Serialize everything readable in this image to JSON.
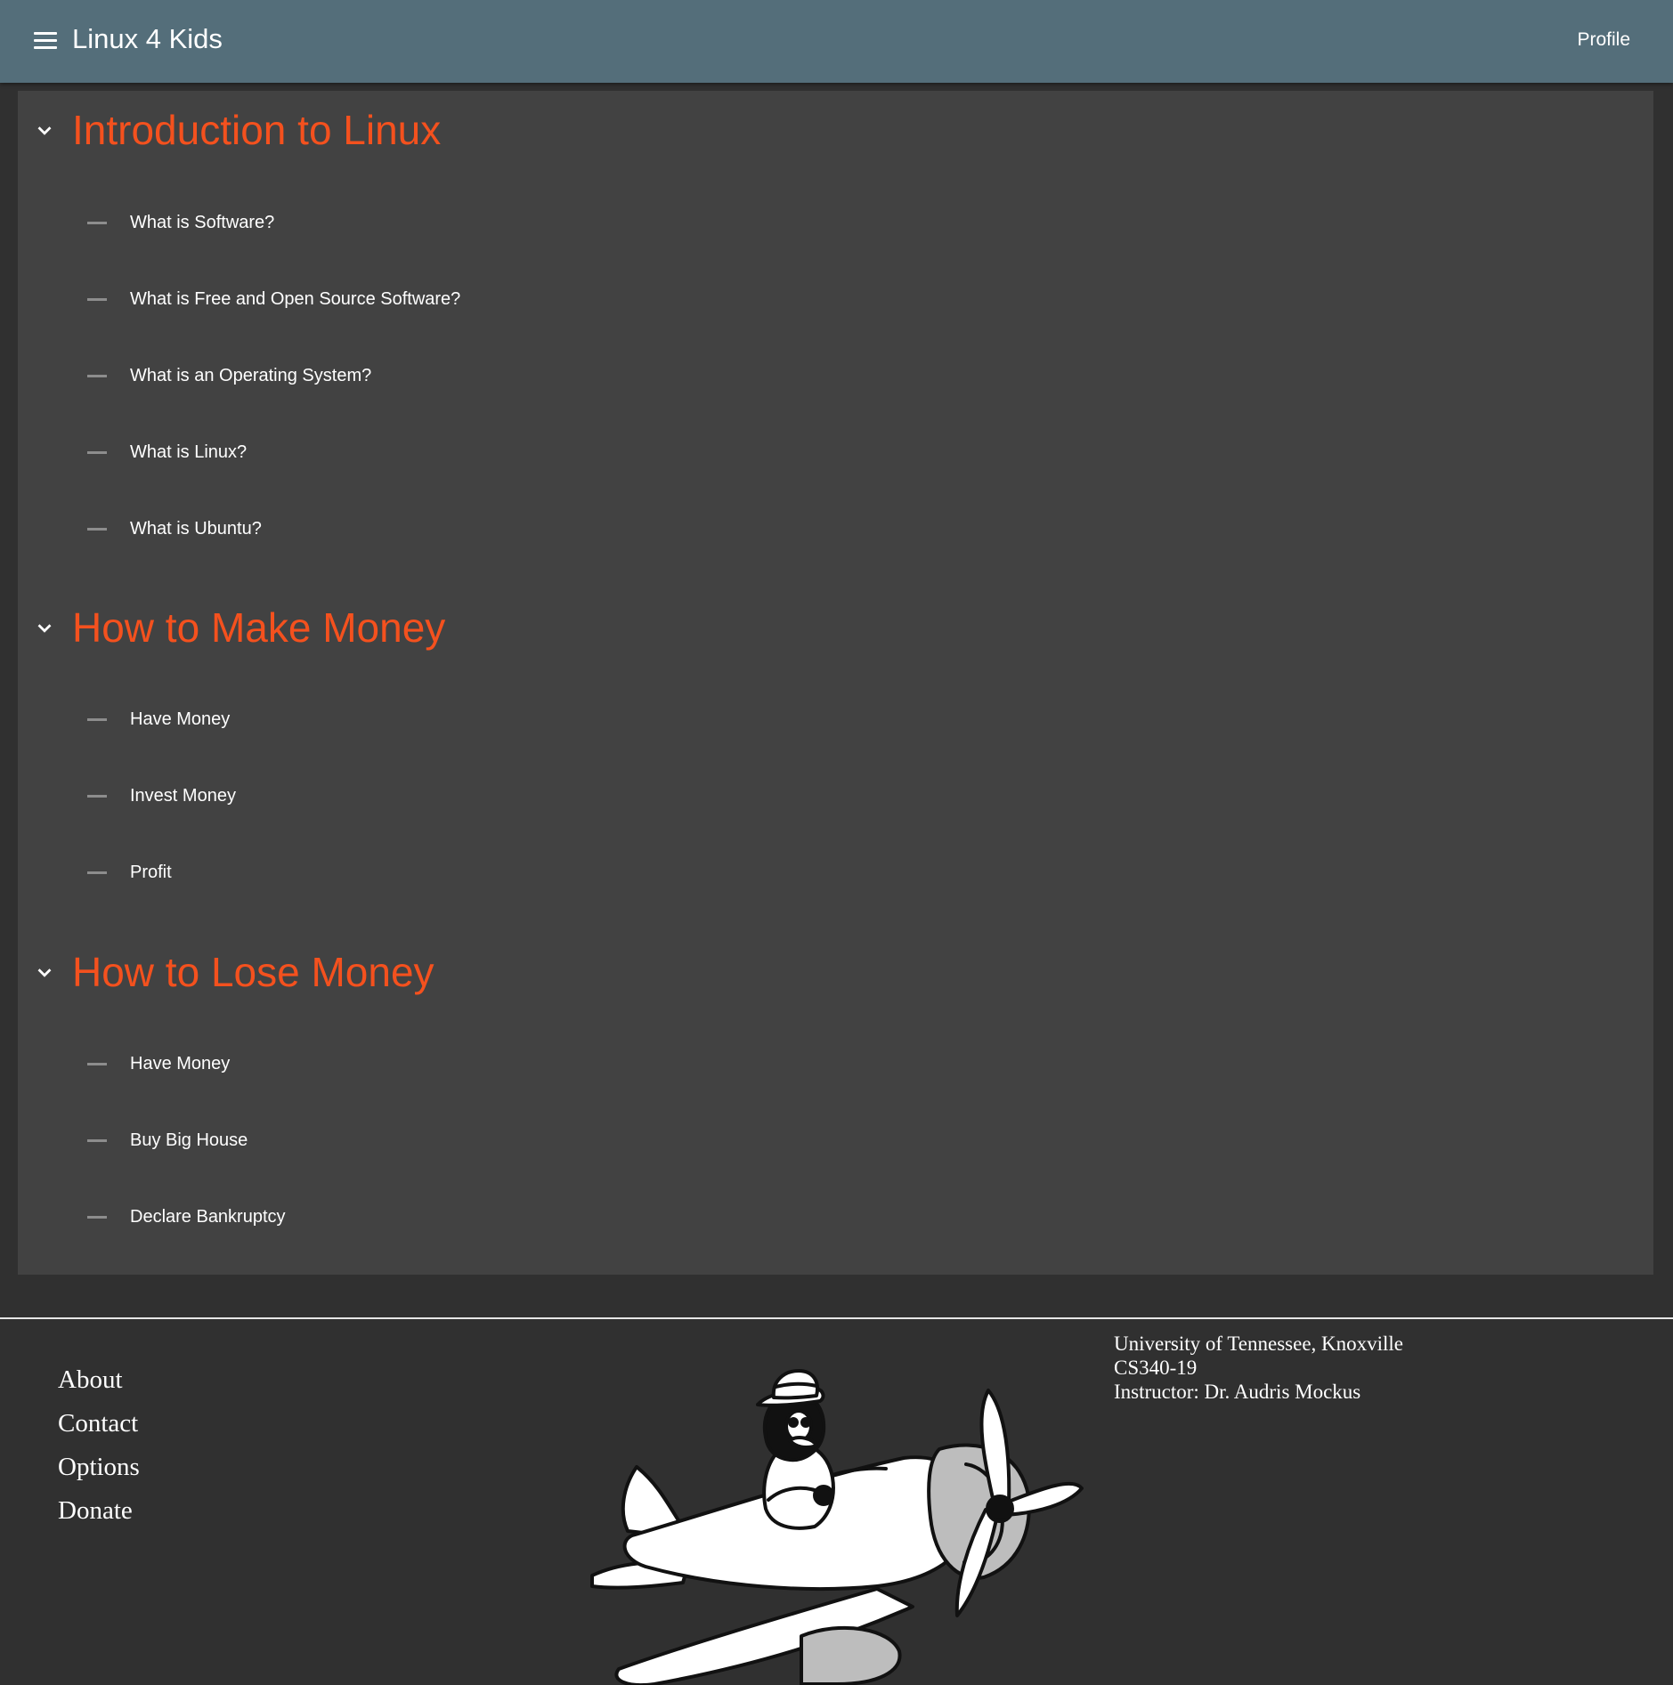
{
  "app": {
    "title": "Linux 4 Kids",
    "profile_label": "Profile",
    "colors": {
      "toolbar": "#546e7a",
      "page_background": "#303030",
      "card_background": "#424242",
      "section_title": "#f4511e"
    }
  },
  "sections": [
    {
      "title": "Introduction to Linux",
      "icon": "chevron-down-icon",
      "items": [
        "What is Software?",
        "What is Free and Open Source Software?",
        "What is an Operating System?",
        "What is Linux?",
        "What is Ubuntu?"
      ]
    },
    {
      "title": "How to Make Money",
      "icon": "chevron-down-icon",
      "items": [
        "Have Money",
        "Invest Money",
        "Profit"
      ]
    },
    {
      "title": "How to Lose Money",
      "icon": "chevron-down-icon",
      "items": [
        "Have Money",
        "Buy Big House",
        "Declare Bankruptcy"
      ]
    }
  ],
  "footer": {
    "links": [
      "About",
      "Contact",
      "Options",
      "Donate"
    ],
    "info": [
      "University of Tennessee, Knoxville",
      "CS340-19",
      "Instructor: Dr. Audris Mockus"
    ],
    "mascot_icon": "penguin-pilot-airplane-illustration"
  }
}
